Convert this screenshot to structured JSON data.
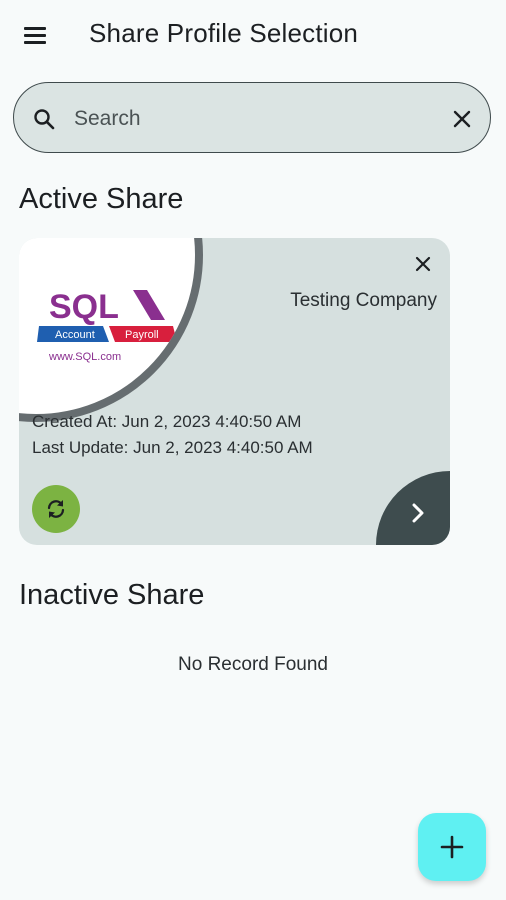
{
  "header": {
    "title": "Share Profile Selection"
  },
  "search": {
    "placeholder": "Search",
    "value": ""
  },
  "active_section": {
    "title": "Active Share"
  },
  "active_card": {
    "company": "Testing Company",
    "created_at": "Created At: Jun 2, 2023 4:40:50 AM",
    "last_update": "Last Update: Jun 2, 2023 4:40:50 AM",
    "logo": {
      "brand": "SQL",
      "tag_account": "Account",
      "tag_payroll": "Payroll",
      "url": "www.SQL.com"
    }
  },
  "inactive_section": {
    "title": "Inactive Share",
    "empty_text": "No Record Found"
  },
  "icons": {
    "menu": "menu-icon",
    "search": "search-icon",
    "clear": "close-icon",
    "card_close": "close-icon",
    "sync": "sync-icon",
    "next": "chevron-right-icon",
    "add": "plus-icon"
  },
  "colors": {
    "background": "#f7fafa",
    "card": "#d6e0df",
    "sync": "#7cb342",
    "fab": "#5ff0f2",
    "next": "#3e4c4e",
    "logo_purple": "#8a2f8f",
    "logo_blue": "#1f5fb0",
    "logo_red": "#d81f3d"
  }
}
